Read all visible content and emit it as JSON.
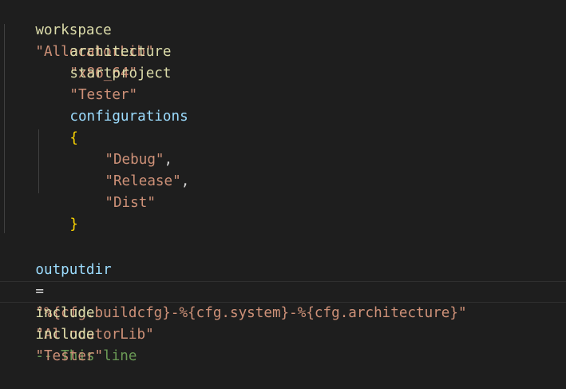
{
  "editor": {
    "lines": {
      "workspace": {
        "keyword": "workspace",
        "value": "\"AllocatorLib\""
      },
      "architecture": {
        "keyword": "architecture",
        "value": "\"x86_64\""
      },
      "startproject": {
        "keyword": "startproject",
        "value": "\"Tester\""
      },
      "configurations": {
        "keyword": "configurations"
      },
      "open_brace": "{",
      "debug": "\"Debug\"",
      "release": "\"Release\"",
      "dist": "\"Dist\"",
      "close_brace": "}",
      "outputdir": {
        "name": "outputdir",
        "op": "=",
        "value": "\"%{cfg.buildcfg}-%{cfg.system}-%{cfg.architecture}\""
      },
      "include1": {
        "keyword": "include",
        "value": "\"AllocatorLib\"",
        "comment": "-- This line"
      },
      "include2": {
        "keyword": "include",
        "value": "\"Tester\""
      }
    },
    "comma": ","
  },
  "colors": {
    "background": "#1e1e1e",
    "function": "#dcdcaa",
    "string": "#ce9178",
    "variable": "#9cdcfe",
    "bracket": "#ffd700",
    "comment": "#6a9955",
    "plain": "#d4d4d4"
  }
}
